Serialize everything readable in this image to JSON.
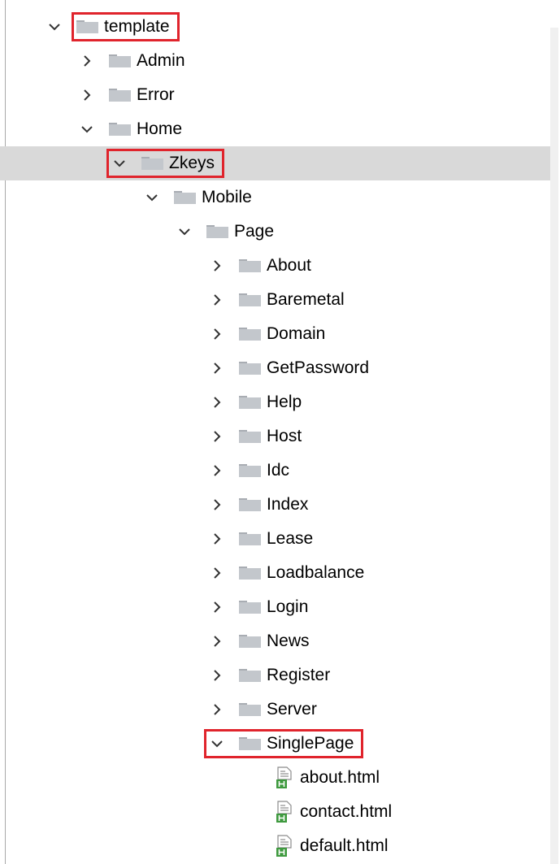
{
  "tree": [
    {
      "label": "template",
      "level": 0,
      "kind": "folder",
      "expanded": true,
      "highlighted": true,
      "selected": false,
      "icon": "folder-icon",
      "chevron": "chevron-down-icon"
    },
    {
      "label": "Admin",
      "level": 1,
      "kind": "folder",
      "expanded": false,
      "highlighted": false,
      "selected": false,
      "icon": "folder-icon",
      "chevron": "chevron-right-icon"
    },
    {
      "label": "Error",
      "level": 1,
      "kind": "folder",
      "expanded": false,
      "highlighted": false,
      "selected": false,
      "icon": "folder-icon",
      "chevron": "chevron-right-icon"
    },
    {
      "label": "Home",
      "level": 1,
      "kind": "folder",
      "expanded": true,
      "highlighted": false,
      "selected": false,
      "icon": "folder-icon",
      "chevron": "chevron-down-icon"
    },
    {
      "label": "Zkeys",
      "level": 2,
      "kind": "folder",
      "expanded": true,
      "highlighted": true,
      "selected": true,
      "icon": "folder-icon",
      "chevron": "chevron-down-icon"
    },
    {
      "label": "Mobile",
      "level": 3,
      "kind": "folder",
      "expanded": true,
      "highlighted": false,
      "selected": false,
      "icon": "folder-icon",
      "chevron": "chevron-down-icon"
    },
    {
      "label": "Page",
      "level": 4,
      "kind": "folder",
      "expanded": true,
      "highlighted": false,
      "selected": false,
      "icon": "folder-icon",
      "chevron": "chevron-down-icon"
    },
    {
      "label": "About",
      "level": 5,
      "kind": "folder",
      "expanded": false,
      "highlighted": false,
      "selected": false,
      "icon": "folder-icon",
      "chevron": "chevron-right-icon"
    },
    {
      "label": "Baremetal",
      "level": 5,
      "kind": "folder",
      "expanded": false,
      "highlighted": false,
      "selected": false,
      "icon": "folder-icon",
      "chevron": "chevron-right-icon"
    },
    {
      "label": "Domain",
      "level": 5,
      "kind": "folder",
      "expanded": false,
      "highlighted": false,
      "selected": false,
      "icon": "folder-icon",
      "chevron": "chevron-right-icon"
    },
    {
      "label": "GetPassword",
      "level": 5,
      "kind": "folder",
      "expanded": false,
      "highlighted": false,
      "selected": false,
      "icon": "folder-icon",
      "chevron": "chevron-right-icon"
    },
    {
      "label": "Help",
      "level": 5,
      "kind": "folder",
      "expanded": false,
      "highlighted": false,
      "selected": false,
      "icon": "folder-icon",
      "chevron": "chevron-right-icon"
    },
    {
      "label": "Host",
      "level": 5,
      "kind": "folder",
      "expanded": false,
      "highlighted": false,
      "selected": false,
      "icon": "folder-icon",
      "chevron": "chevron-right-icon"
    },
    {
      "label": "Idc",
      "level": 5,
      "kind": "folder",
      "expanded": false,
      "highlighted": false,
      "selected": false,
      "icon": "folder-icon",
      "chevron": "chevron-right-icon"
    },
    {
      "label": "Index",
      "level": 5,
      "kind": "folder",
      "expanded": false,
      "highlighted": false,
      "selected": false,
      "icon": "folder-icon",
      "chevron": "chevron-right-icon"
    },
    {
      "label": "Lease",
      "level": 5,
      "kind": "folder",
      "expanded": false,
      "highlighted": false,
      "selected": false,
      "icon": "folder-icon",
      "chevron": "chevron-right-icon"
    },
    {
      "label": "Loadbalance",
      "level": 5,
      "kind": "folder",
      "expanded": false,
      "highlighted": false,
      "selected": false,
      "icon": "folder-icon",
      "chevron": "chevron-right-icon"
    },
    {
      "label": "Login",
      "level": 5,
      "kind": "folder",
      "expanded": false,
      "highlighted": false,
      "selected": false,
      "icon": "folder-icon",
      "chevron": "chevron-right-icon"
    },
    {
      "label": "News",
      "level": 5,
      "kind": "folder",
      "expanded": false,
      "highlighted": false,
      "selected": false,
      "icon": "folder-icon",
      "chevron": "chevron-right-icon"
    },
    {
      "label": "Register",
      "level": 5,
      "kind": "folder",
      "expanded": false,
      "highlighted": false,
      "selected": false,
      "icon": "folder-icon",
      "chevron": "chevron-right-icon"
    },
    {
      "label": "Server",
      "level": 5,
      "kind": "folder",
      "expanded": false,
      "highlighted": false,
      "selected": false,
      "icon": "folder-icon",
      "chevron": "chevron-right-icon"
    },
    {
      "label": "SinglePage",
      "level": 5,
      "kind": "folder",
      "expanded": true,
      "highlighted": true,
      "selected": false,
      "icon": "folder-icon",
      "chevron": "chevron-down-icon"
    },
    {
      "label": "about.html",
      "level": 6,
      "kind": "file",
      "expanded": false,
      "highlighted": false,
      "selected": false,
      "icon": "html-file-icon",
      "chevron": ""
    },
    {
      "label": "contact.html",
      "level": 6,
      "kind": "file",
      "expanded": false,
      "highlighted": false,
      "selected": false,
      "icon": "html-file-icon",
      "chevron": ""
    },
    {
      "label": "default.html",
      "level": 6,
      "kind": "file",
      "expanded": false,
      "highlighted": false,
      "selected": false,
      "icon": "html-file-icon",
      "chevron": ""
    }
  ],
  "colors": {
    "highlight_box": "#e0242c",
    "selected_row": "#d9d9d9",
    "folder_body": "#c3c7cc",
    "folder_tab": "#a9adb3",
    "file_icon_green": "#3f9a3f",
    "chevron": "#333333"
  }
}
